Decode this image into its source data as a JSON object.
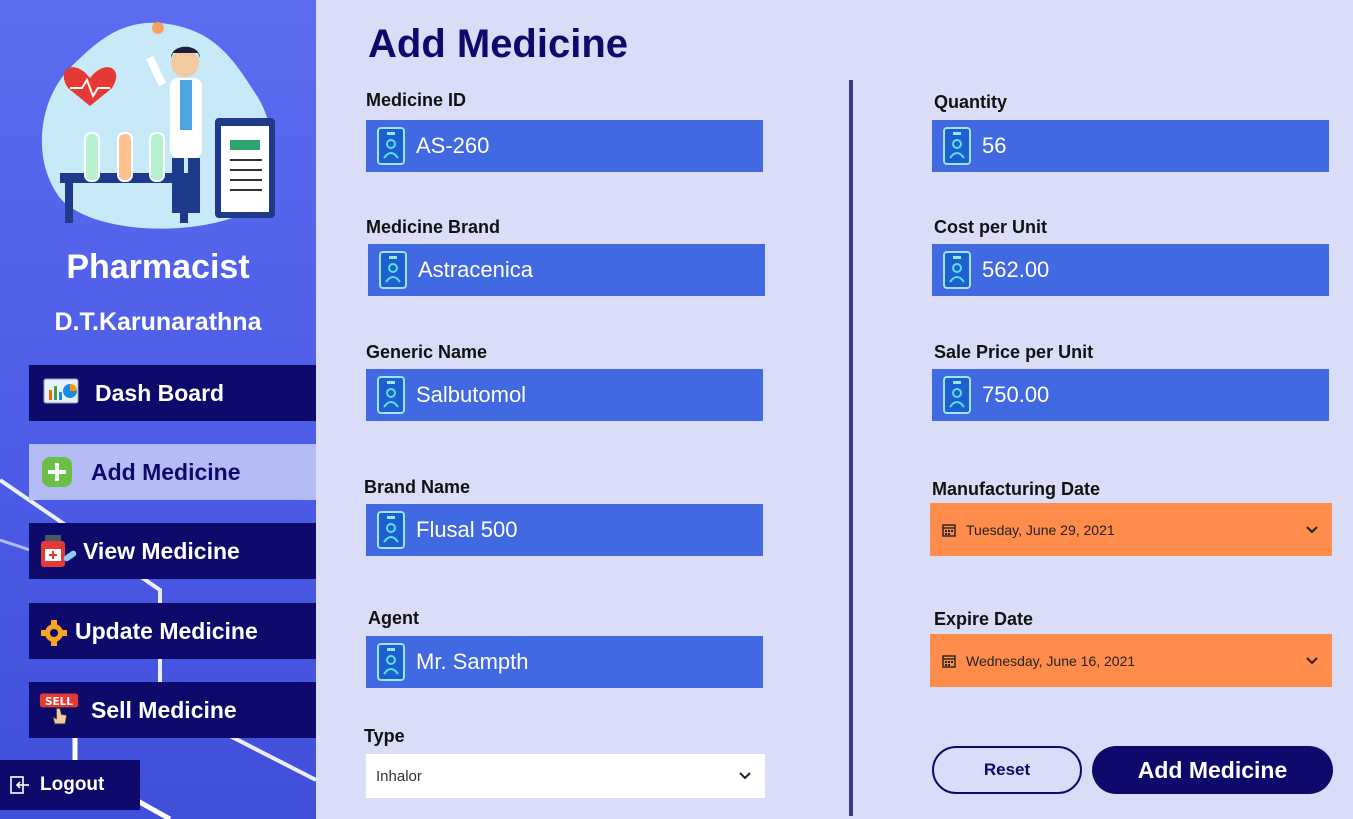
{
  "sidebar": {
    "role": "Pharmacist",
    "user_name": "D.T.Karunarathna",
    "nav": [
      {
        "label": "Dash Board",
        "icon": "dashboard-chart-icon"
      },
      {
        "label": "Add Medicine",
        "icon": "plus-icon"
      },
      {
        "label": "View Medicine",
        "icon": "medicine-bottle-icon"
      },
      {
        "label": "Update Medicine",
        "icon": "gear-icon"
      },
      {
        "label": "Sell Medicine",
        "icon": "sell-hand-icon"
      }
    ],
    "active": "Add Medicine",
    "logout_label": "Logout"
  },
  "page": {
    "title": "Add Medicine"
  },
  "form": {
    "medicine_id": {
      "label": "Medicine ID",
      "value": "AS-260"
    },
    "medicine_brand": {
      "label": "Medicine Brand",
      "value": "Astracenica"
    },
    "generic_name": {
      "label": "Generic Name",
      "value": "Salbutomol"
    },
    "brand_name": {
      "label": "Brand Name",
      "value": "Flusal 500"
    },
    "agent": {
      "label": "Agent",
      "value": "Mr. Sampth"
    },
    "type": {
      "label": "Type",
      "value": "Inhalor"
    },
    "quantity": {
      "label": "Quantity",
      "value": "56"
    },
    "cost_per_unit": {
      "label": "Cost per Unit",
      "value": "562.00"
    },
    "sale_price_per_unit": {
      "label": "Sale Price per Unit",
      "value": "750.00"
    },
    "manufacturing_date": {
      "label": "Manufacturing Date",
      "value": "Tuesday, June 29, 2021"
    },
    "expire_date": {
      "label": "Expire Date",
      "value": "Wednesday, June 16, 2021"
    }
  },
  "actions": {
    "reset_label": "Reset",
    "add_label": "Add Medicine"
  },
  "colors": {
    "navy": "#0d0a6b",
    "field_blue": "#4169e1",
    "date_orange": "#ff8c4a",
    "background": "#d9ddf8"
  }
}
